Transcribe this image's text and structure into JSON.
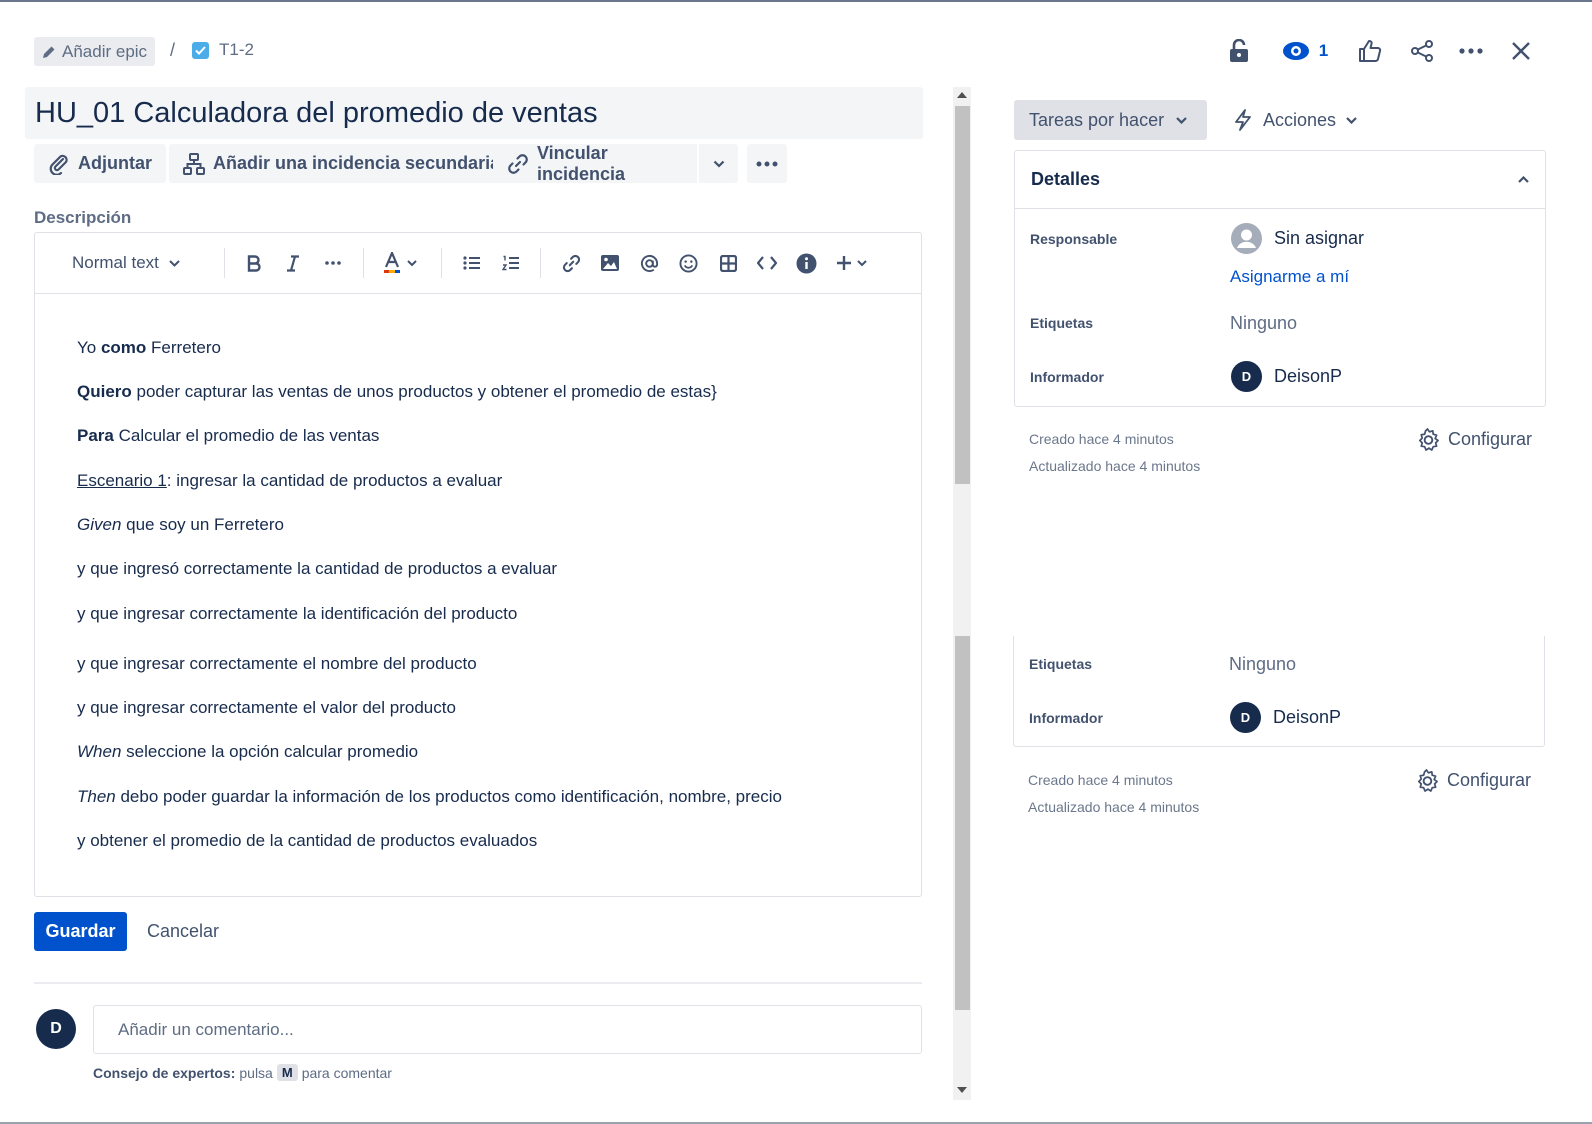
{
  "breadcrumb": {
    "epic_label": "Añadir epic",
    "separator": "/",
    "issue_key": "T1-2"
  },
  "header_actions": {
    "watch_count": "1"
  },
  "issue": {
    "summary": "HU_01 Calculadora del promedio de ventas"
  },
  "actions": {
    "attach": "Adjuntar",
    "add_child": "Añadir una incidencia secundaria",
    "link_issue": "Vincular incidencia"
  },
  "description": {
    "label": "Descripción",
    "toolbar": {
      "text_style": "Normal text"
    },
    "lines": [
      {
        "pre": "Yo ",
        "bold": "como",
        "post": " Ferretero"
      },
      {
        "bold": "Quiero",
        "post": " poder capturar las ventas de unos productos y obtener el promedio de estas}"
      },
      {
        "bold": "Para",
        "post": " Calcular el promedio de las ventas"
      },
      {
        "underline": "Escenario 1",
        "post": ": ingresar la cantidad de productos a evaluar"
      },
      {
        "italic": "Given",
        "post": " que soy un Ferretero"
      },
      {
        "post": "y que ingresó correctamente la cantidad de productos a evaluar"
      },
      {
        "post": "y que ingresar correctamente la identificación del producto"
      },
      {
        "post": "y que ingresar correctamente el nombre del producto"
      },
      {
        "post": "y que ingresar correctamente el valor del producto"
      },
      {
        "italic": "When",
        "post": " seleccione la opción calcular promedio"
      },
      {
        "italic": "Then",
        "post": " debo poder guardar la información de los productos como identificación, nombre, precio"
      },
      {
        "post": "y obtener el promedio de la cantidad de productos evaluados"
      }
    ]
  },
  "editor_buttons": {
    "save": "Guardar",
    "cancel": "Cancelar"
  },
  "comment": {
    "avatar_initial": "D",
    "placeholder": "Añadir un comentario...",
    "tip_prefix": "Consejo de expertos:",
    "tip_mid": "pulsa",
    "tip_key": "M",
    "tip_suffix": "para comentar"
  },
  "sidebar": {
    "status": "Tareas por hacer",
    "actions": "Acciones",
    "details_title": "Detalles",
    "assignee_label": "Responsable",
    "assignee_value": "Sin asignar",
    "assign_me": "Asignarme a mí",
    "labels_label": "Etiquetas",
    "labels_value": "Ninguno",
    "reporter_label": "Informador",
    "reporter_initial": "D",
    "reporter_value": "DeisonP",
    "created": "Creado hace 4 minutos",
    "updated": "Actualizado hace 4 minutos",
    "configure": "Configurar"
  },
  "colors": {
    "primary": "#0052cc",
    "text": "#172b4d",
    "subtle": "#42526e",
    "task_icon": "#4bade8"
  }
}
